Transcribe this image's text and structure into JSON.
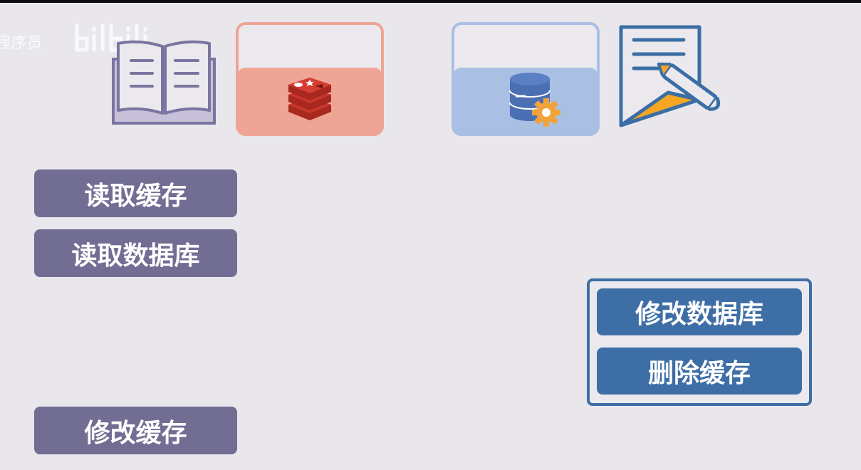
{
  "watermark": {
    "text": "程序员",
    "logo": "bilibili"
  },
  "icons": {
    "book": "book-icon",
    "cache": "redis-icon",
    "database": "database-gear-icon",
    "document": "document-pen-icon"
  },
  "labels": {
    "read_cache": "读取缓存",
    "read_db": "读取数据库",
    "modify_cache": "修改缓存"
  },
  "group": {
    "modify_db": "修改数据库",
    "delete_cache": "删除缓存"
  },
  "colors": {
    "background": "#e9e7ec",
    "purple_label": "#726d93",
    "blue_label": "#3e6ea6",
    "cache_fill": "#eea596",
    "db_fill": "#a9bfe4",
    "redis_red": "#c9372c"
  }
}
